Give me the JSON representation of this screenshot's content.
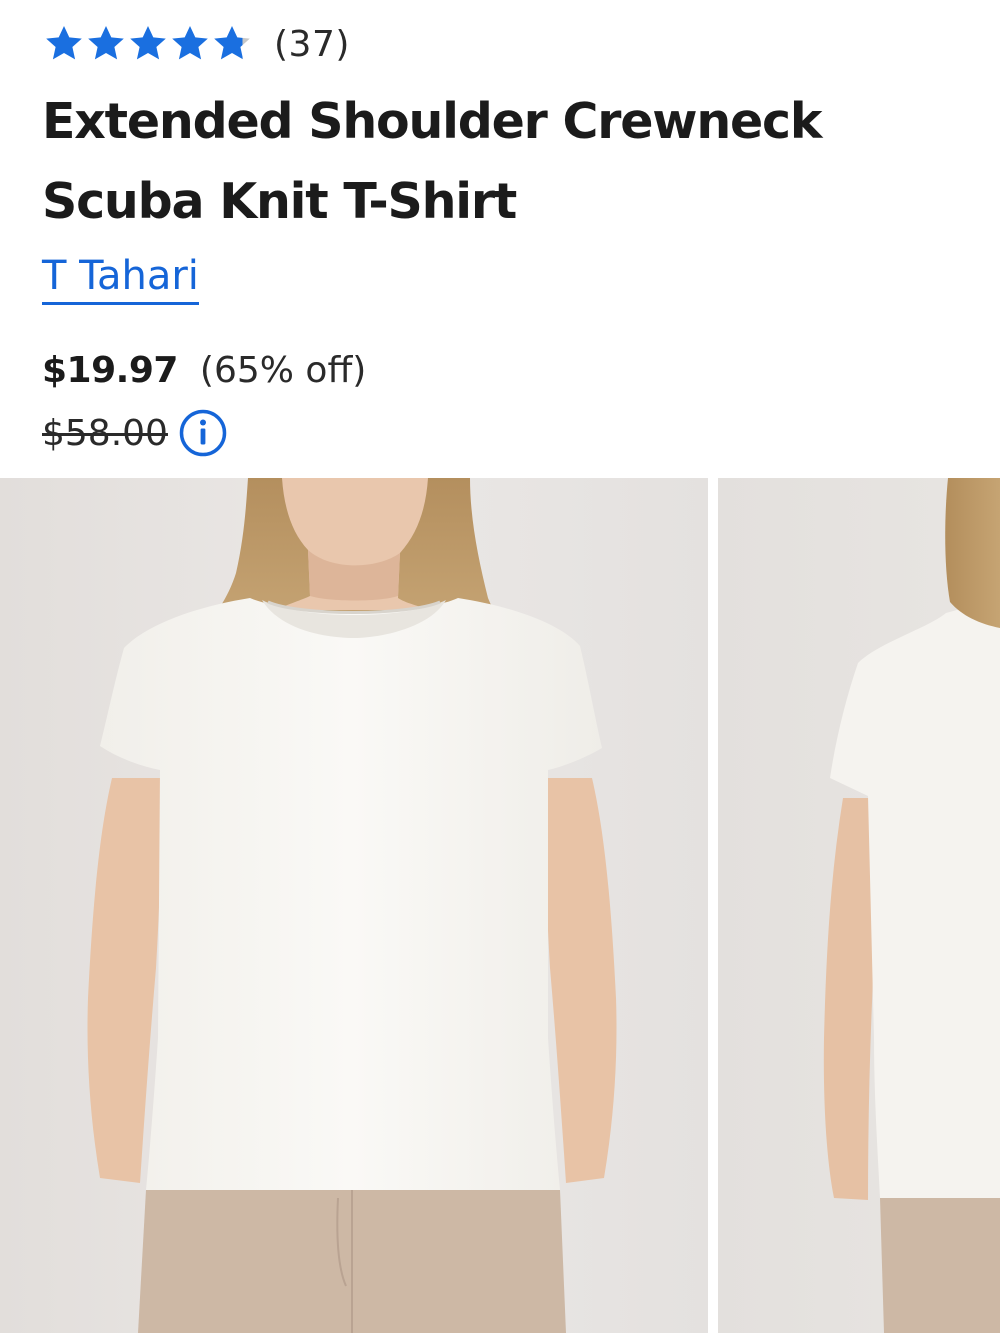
{
  "product": {
    "rating": {
      "stars": 5,
      "filled": 4.8,
      "count": "(37)"
    },
    "title": "Extended Shoulder Crewneck Scuba Knit T-Shirt",
    "brand": "T Tahari",
    "price": {
      "sale": "$19.97",
      "discount": "(65% off)",
      "original": "$58.00"
    }
  },
  "icons": {
    "star": "star-icon",
    "info": "info-icon"
  },
  "colors": {
    "accent": "#1565d8",
    "star": "#1a6fe0",
    "text": "#1b1b1b"
  }
}
